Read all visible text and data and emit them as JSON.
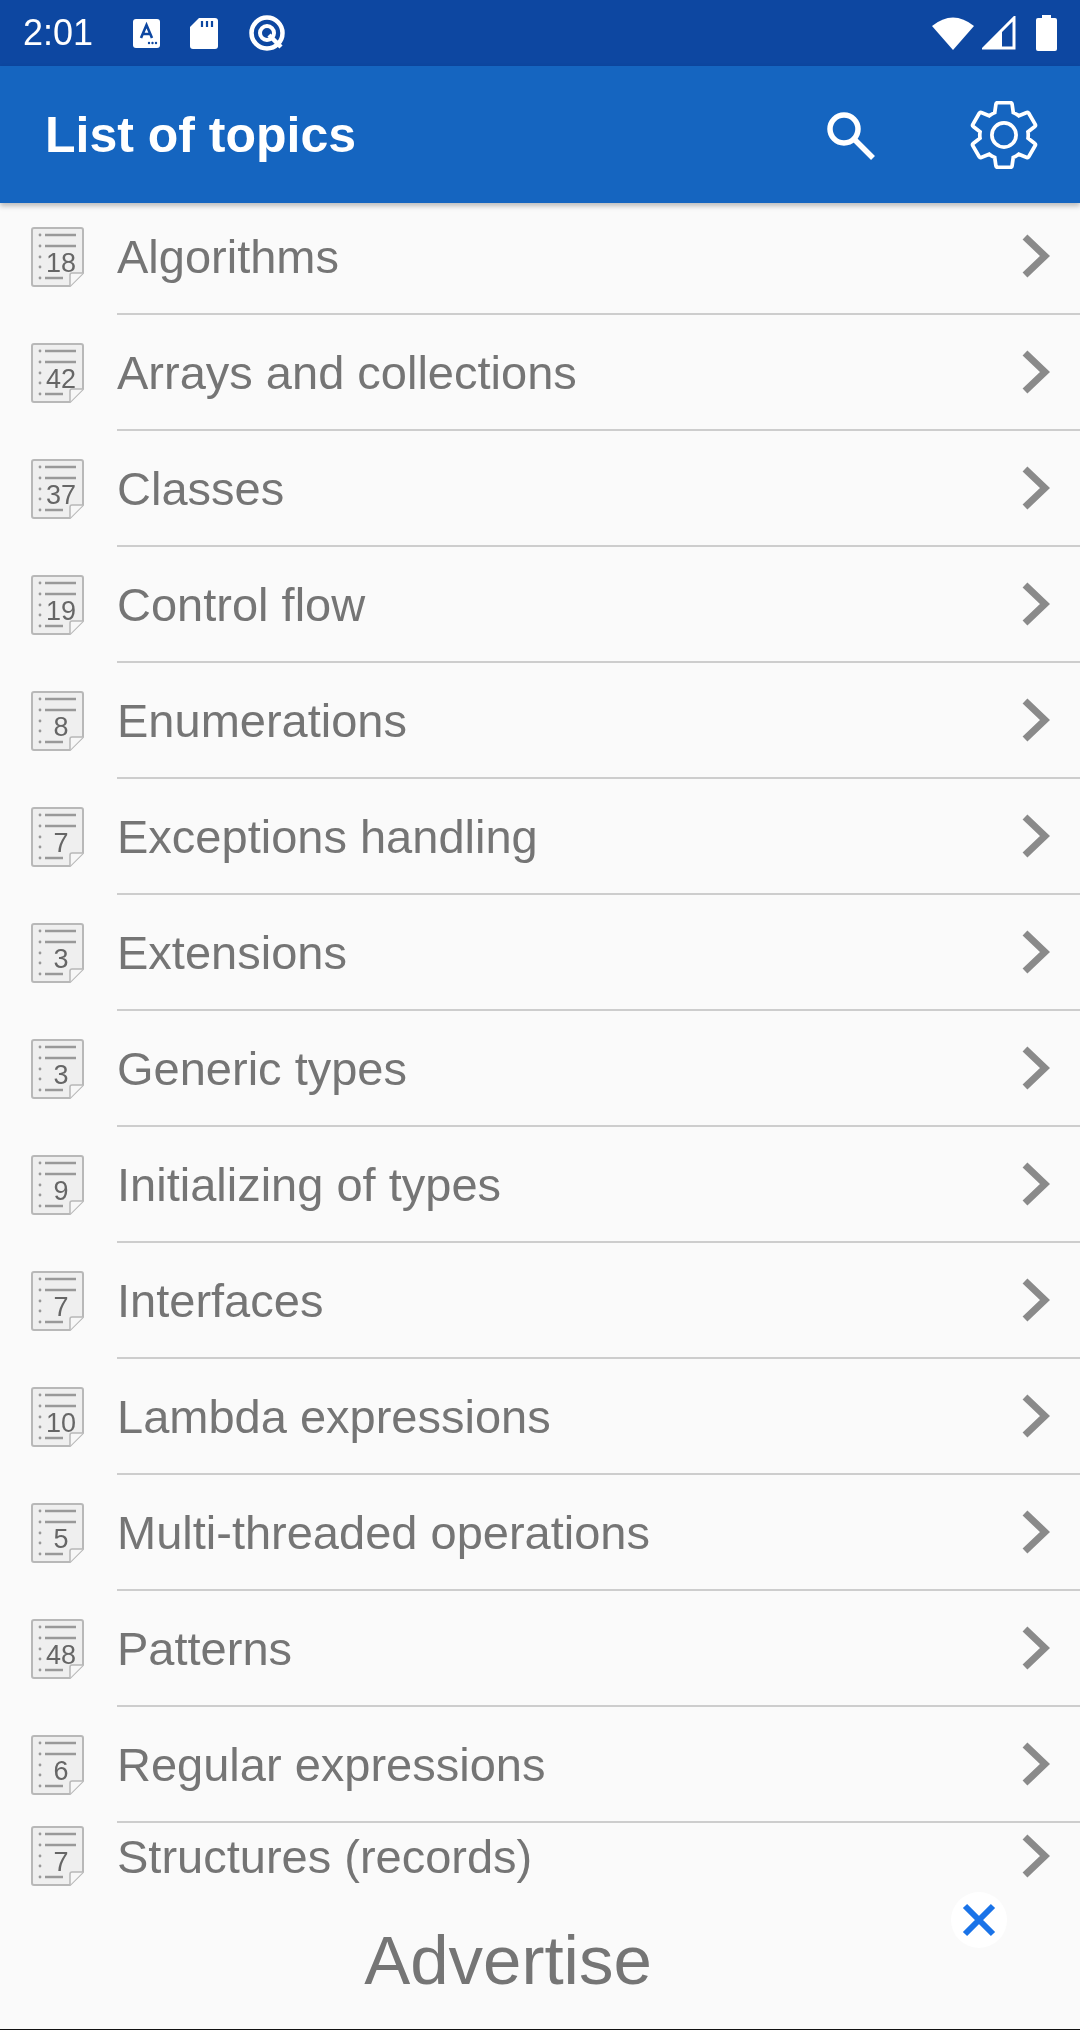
{
  "status_bar": {
    "time": "2:01"
  },
  "app_bar": {
    "title": "List of topics"
  },
  "topics": [
    {
      "title": "Algorithms",
      "count": "18"
    },
    {
      "title": "Arrays and collections",
      "count": "42"
    },
    {
      "title": "Classes",
      "count": "37"
    },
    {
      "title": "Control flow",
      "count": "19"
    },
    {
      "title": "Enumerations",
      "count": "8"
    },
    {
      "title": "Exceptions handling",
      "count": "7"
    },
    {
      "title": "Extensions",
      "count": "3"
    },
    {
      "title": "Generic types",
      "count": "3"
    },
    {
      "title": "Initializing of types",
      "count": "9"
    },
    {
      "title": "Interfaces",
      "count": "7"
    },
    {
      "title": "Lambda expressions",
      "count": "10"
    },
    {
      "title": "Multi-threaded operations",
      "count": "5"
    },
    {
      "title": "Patterns",
      "count": "48"
    },
    {
      "title": "Regular expressions",
      "count": "6"
    },
    {
      "title": "Structures (records)",
      "count": "7"
    }
  ],
  "ad_banner": {
    "label": "Advertise"
  }
}
